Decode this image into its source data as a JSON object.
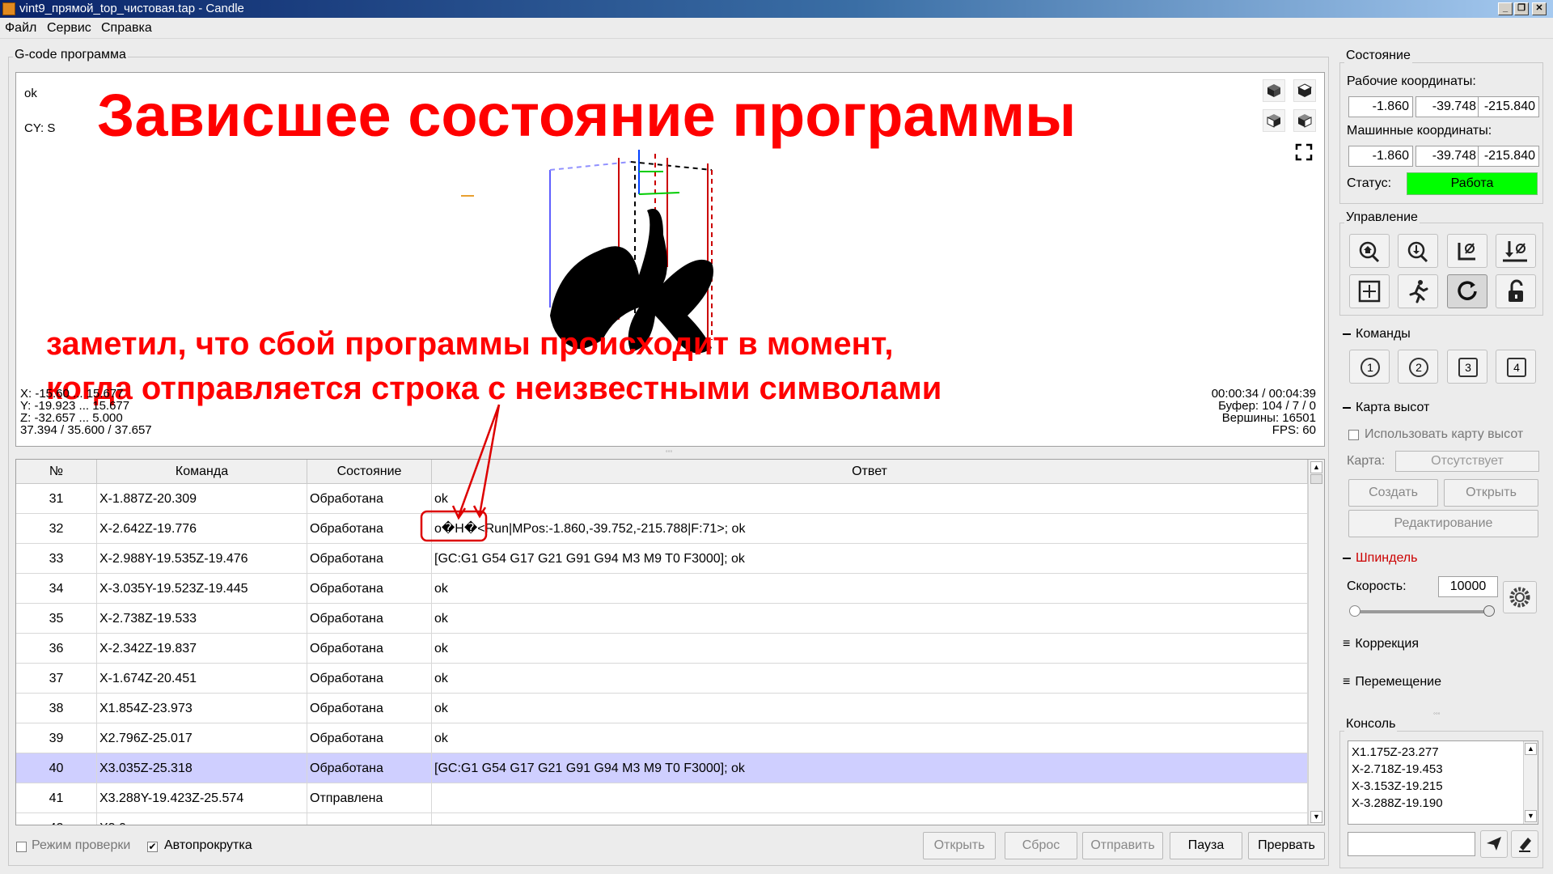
{
  "window": {
    "title": "vint9_прямой_top_чистовая.tap - Candle",
    "btn_min": "_",
    "btn_max": "❐",
    "btn_close": "✕"
  },
  "menu": {
    "file": "Файл",
    "service": "Сервис",
    "help": "Справка"
  },
  "gcode_group": {
    "title": "G-code программа"
  },
  "viz": {
    "status_ok": "ok",
    "cs": "CY: S",
    "coord_x": "X: -15.60 ... 15.677",
    "coord_y": "Y: -19.923 ... 15.677",
    "coord_z": "Z: -32.657 ... 5.000",
    "coord_dims": "37.394 / 35.600 / 37.657",
    "time": "00:00:34 / 00:04:39",
    "buffer": "Буфер: 104 / 7 / 0",
    "vertices": "Вершины: 16501",
    "fps": "FPS: 60"
  },
  "annotation": {
    "headline": "Зависшее состояние программы",
    "note_line1": "заметил, что сбой программы происходит в момент,",
    "note_line2": "когда отправляется строка с неизвестными символами",
    "overlay_text": "ok",
    "color": "#ff0000"
  },
  "table": {
    "headers": {
      "num": "№",
      "cmd": "Команда",
      "state": "Состояние",
      "resp": "Ответ"
    },
    "rows": [
      {
        "num": "31",
        "cmd": "X-1.887Z-20.309",
        "state": "Обработана",
        "resp": "ok"
      },
      {
        "num": "32",
        "cmd": "X-2.642Z-19.776",
        "state": "Обработана",
        "resp": "o�H�<Run|MPos:-1.860,-39.752,-215.788|F:71>; ok"
      },
      {
        "num": "33",
        "cmd": "X-2.988Y-19.535Z-19.476",
        "state": "Обработана",
        "resp": "[GC:G1 G54 G17 G21 G91 G94 M3 M9 T0 F3000]; ok"
      },
      {
        "num": "34",
        "cmd": "X-3.035Y-19.523Z-19.445",
        "state": "Обработана",
        "resp": "ok"
      },
      {
        "num": "35",
        "cmd": "X-2.738Z-19.533",
        "state": "Обработана",
        "resp": "ok"
      },
      {
        "num": "36",
        "cmd": "X-2.342Z-19.837",
        "state": "Обработана",
        "resp": "ok"
      },
      {
        "num": "37",
        "cmd": "X-1.674Z-20.451",
        "state": "Обработана",
        "resp": "ok"
      },
      {
        "num": "38",
        "cmd": "X1.854Z-23.973",
        "state": "Обработана",
        "resp": "ok"
      },
      {
        "num": "39",
        "cmd": "X2.796Z-25.017",
        "state": "Обработана",
        "resp": "ok"
      },
      {
        "num": "40",
        "cmd": "X3.035Z-25.318",
        "state": "Обработана",
        "resp": "[GC:G1 G54 G17 G21 G91 G94 M3 M9 T0 F3000]; ok"
      },
      {
        "num": "41",
        "cmd": "X3.288Y-19.423Z-25.574",
        "state": "Отправлена",
        "resp": ""
      },
      {
        "num": "42",
        "cmd": "X3.0...",
        "state": "",
        "resp": ""
      }
    ]
  },
  "bottom": {
    "check_mode": "Режим проверки",
    "autoscroll": "Автопрокрутка",
    "open": "Открыть",
    "reset": "Сброс",
    "send": "Отправить",
    "pause": "Пауза",
    "abort": "Прервать"
  },
  "state_group": {
    "title": "Состояние",
    "work_label": "Рабочие координаты:",
    "work": [
      "-1.860",
      "-39.748",
      "-215.840"
    ],
    "machine_label": "Машинные координаты:",
    "machine": [
      "-1.860",
      "-39.748",
      "-215.840"
    ],
    "status_label": "Статус:",
    "status": "Работа",
    "status_color": "#00ff00"
  },
  "control_group": {
    "title": "Управление"
  },
  "commands_group": {
    "title": "Команды",
    "buttons": [
      "1",
      "2",
      "3",
      "4"
    ]
  },
  "heightmap_group": {
    "title": "Карта высот",
    "use": "Использовать карту высот",
    "map_label": "Карта:",
    "map_value": "Отсутствует",
    "create": "Создать",
    "open": "Открыть",
    "edit": "Редактирование"
  },
  "spindle_group": {
    "title": "Шпиндель",
    "speed_label": "Скорость:",
    "speed": "10000",
    "slider_level": 1.0
  },
  "correction": {
    "title": "Коррекция"
  },
  "movement": {
    "title": "Перемещение"
  },
  "console": {
    "title": "Консоль",
    "lines": [
      "X1.175Z-23.277",
      "X-2.718Z-19.453",
      "X-3.153Z-19.215",
      "X-3.288Z-19.190"
    ]
  }
}
